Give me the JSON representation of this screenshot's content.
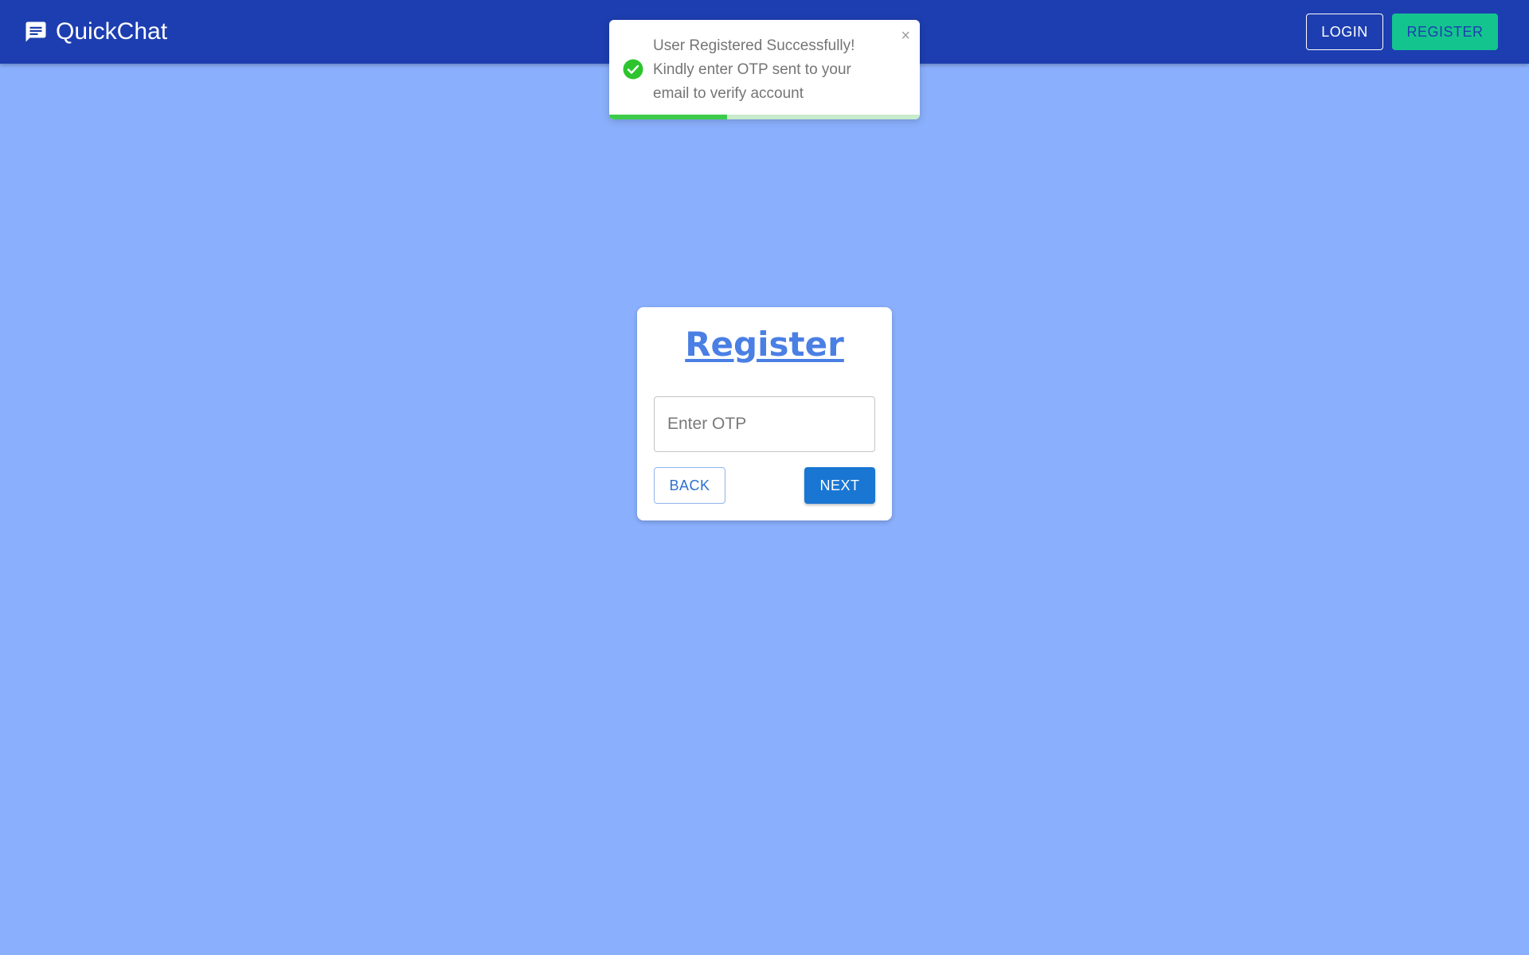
{
  "app": {
    "title": "QuickChat",
    "brand_icon": "chat-bubble-icon"
  },
  "nav": {
    "login_label": "LOGIN",
    "register_label": "REGISTER"
  },
  "toast": {
    "message": "User Registered Successfully! Kindly enter OTP sent to your email to verify account",
    "icon": "check-circle-icon",
    "close_symbol": "×",
    "progress_fraction": 0.38,
    "status_color": "#3dcc4a"
  },
  "register_card": {
    "title": "Register",
    "otp_placeholder": "Enter OTP",
    "otp_value": "",
    "back_label": "BACK",
    "next_label": "NEXT"
  },
  "colors": {
    "page_background": "#8aaffc",
    "appbar": "#1d3eb0",
    "accent_green": "#14c48f",
    "primary_blue": "#1976d2",
    "title_blue": "#4a7fe4"
  }
}
